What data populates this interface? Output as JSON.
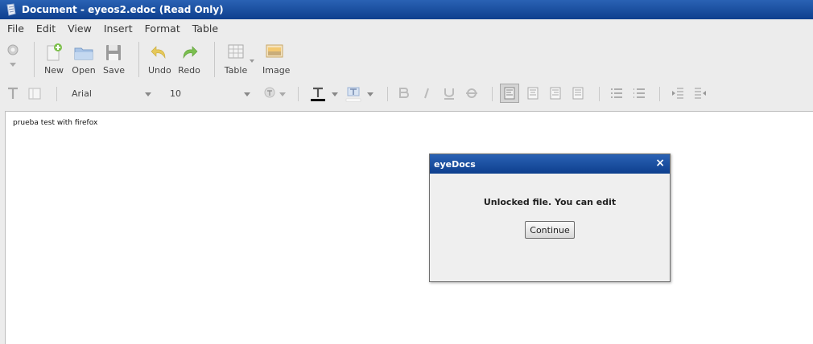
{
  "window": {
    "title": "Document - eyeos2.edoc (Read Only)"
  },
  "menu": [
    "File",
    "Edit",
    "View",
    "Insert",
    "Format",
    "Table"
  ],
  "toolbar": {
    "new": "New",
    "open": "Open",
    "save": "Save",
    "undo": "Undo",
    "redo": "Redo",
    "table": "Table",
    "image": "Image"
  },
  "format": {
    "font": "Arial",
    "size": "10"
  },
  "document": {
    "text": "prueba test with firefox"
  },
  "dialog": {
    "title": "eyeDocs",
    "close": "×",
    "message": "Unlocked file. You can edit",
    "button": "Continue"
  },
  "colors": {
    "titlebar": "#1a4fa0",
    "accent_green": "#6cb33f",
    "undo_yellow": "#e8c84a"
  }
}
